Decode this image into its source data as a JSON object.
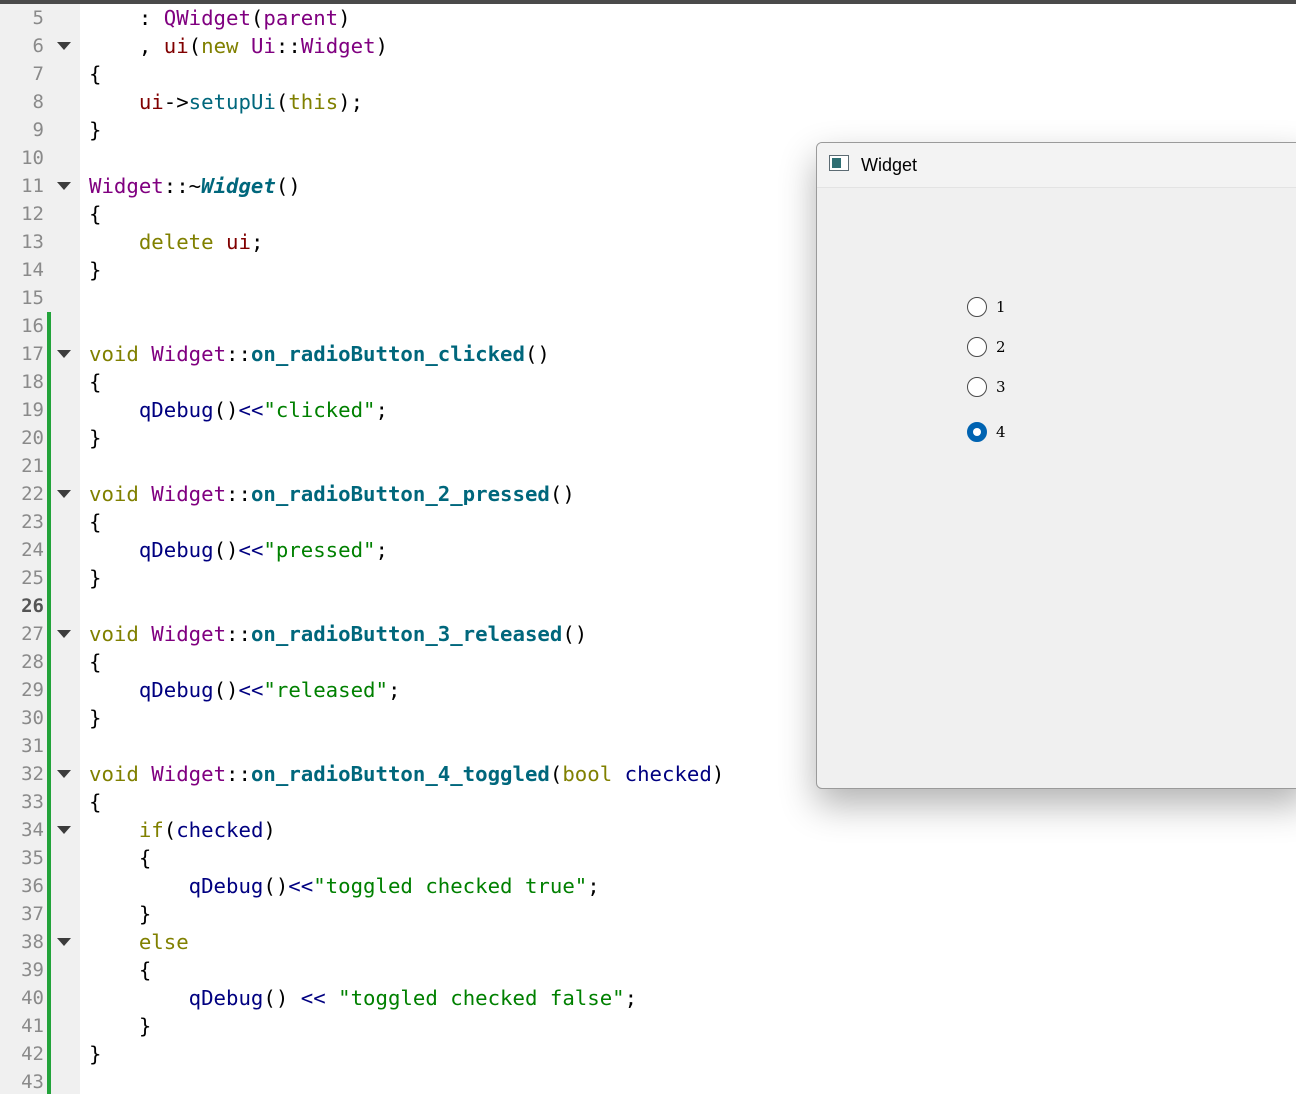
{
  "editor": {
    "current_line": "26",
    "lines": [
      {
        "n": "5",
        "fold": false,
        "tokens": [
          {
            "c": "op",
            "t": "    : "
          },
          {
            "c": "t",
            "t": "QWidget"
          },
          {
            "c": "op",
            "t": "("
          },
          {
            "c": "t",
            "t": "parent"
          },
          {
            "c": "op",
            "t": ")"
          }
        ]
      },
      {
        "n": "6",
        "fold": true,
        "tokens": [
          {
            "c": "op",
            "t": "    , "
          },
          {
            "c": "m",
            "t": "ui"
          },
          {
            "c": "op",
            "t": "("
          },
          {
            "c": "k",
            "t": "new"
          },
          {
            "c": "op",
            "t": " "
          },
          {
            "c": "t",
            "t": "Ui"
          },
          {
            "c": "op",
            "t": "::"
          },
          {
            "c": "t",
            "t": "Widget"
          },
          {
            "c": "op",
            "t": ")"
          }
        ]
      },
      {
        "n": "7",
        "fold": false,
        "tokens": [
          {
            "c": "op",
            "t": "{"
          }
        ]
      },
      {
        "n": "8",
        "fold": false,
        "tokens": [
          {
            "c": "op",
            "t": "    "
          },
          {
            "c": "m",
            "t": "ui"
          },
          {
            "c": "op",
            "t": "->"
          },
          {
            "c": "f",
            "t": "setupUi"
          },
          {
            "c": "op",
            "t": "("
          },
          {
            "c": "k",
            "t": "this"
          },
          {
            "c": "op",
            "t": ");"
          }
        ]
      },
      {
        "n": "9",
        "fold": false,
        "tokens": [
          {
            "c": "op",
            "t": "}"
          }
        ]
      },
      {
        "n": "10",
        "fold": false,
        "tokens": []
      },
      {
        "n": "11",
        "fold": true,
        "tokens": [
          {
            "c": "t",
            "t": "Widget"
          },
          {
            "c": "op",
            "t": "::~"
          },
          {
            "c": "fi",
            "t": "Widget"
          },
          {
            "c": "op",
            "t": "()"
          }
        ]
      },
      {
        "n": "12",
        "fold": false,
        "tokens": [
          {
            "c": "op",
            "t": "{"
          }
        ]
      },
      {
        "n": "13",
        "fold": false,
        "tokens": [
          {
            "c": "op",
            "t": "    "
          },
          {
            "c": "k",
            "t": "delete"
          },
          {
            "c": "op",
            "t": " "
          },
          {
            "c": "m",
            "t": "ui"
          },
          {
            "c": "op",
            "t": ";"
          }
        ]
      },
      {
        "n": "14",
        "fold": false,
        "tokens": [
          {
            "c": "op",
            "t": "}"
          }
        ]
      },
      {
        "n": "15",
        "fold": false,
        "tokens": []
      },
      {
        "n": "16",
        "fold": false,
        "tokens": []
      },
      {
        "n": "17",
        "fold": true,
        "tokens": [
          {
            "c": "k",
            "t": "void"
          },
          {
            "c": "op",
            "t": " "
          },
          {
            "c": "t",
            "t": "Widget"
          },
          {
            "c": "op",
            "t": "::"
          },
          {
            "c": "fb",
            "t": "on_radioButton_clicked"
          },
          {
            "c": "op",
            "t": "()"
          }
        ]
      },
      {
        "n": "18",
        "fold": false,
        "tokens": [
          {
            "c": "op",
            "t": "{"
          }
        ]
      },
      {
        "n": "19",
        "fold": false,
        "tokens": [
          {
            "c": "op",
            "t": "    "
          },
          {
            "c": "q",
            "t": "qDebug"
          },
          {
            "c": "op",
            "t": "()"
          },
          {
            "c": "q",
            "t": "<<"
          },
          {
            "c": "s",
            "t": "\"clicked\""
          },
          {
            "c": "op",
            "t": ";"
          }
        ]
      },
      {
        "n": "20",
        "fold": false,
        "tokens": [
          {
            "c": "op",
            "t": "}"
          }
        ]
      },
      {
        "n": "21",
        "fold": false,
        "tokens": []
      },
      {
        "n": "22",
        "fold": true,
        "tokens": [
          {
            "c": "k",
            "t": "void"
          },
          {
            "c": "op",
            "t": " "
          },
          {
            "c": "t",
            "t": "Widget"
          },
          {
            "c": "op",
            "t": "::"
          },
          {
            "c": "fb",
            "t": "on_radioButton_2_pressed"
          },
          {
            "c": "op",
            "t": "()"
          }
        ]
      },
      {
        "n": "23",
        "fold": false,
        "tokens": [
          {
            "c": "op",
            "t": "{"
          }
        ]
      },
      {
        "n": "24",
        "fold": false,
        "tokens": [
          {
            "c": "op",
            "t": "    "
          },
          {
            "c": "q",
            "t": "qDebug"
          },
          {
            "c": "op",
            "t": "()"
          },
          {
            "c": "q",
            "t": "<<"
          },
          {
            "c": "s",
            "t": "\"pressed\""
          },
          {
            "c": "op",
            "t": ";"
          }
        ]
      },
      {
        "n": "25",
        "fold": false,
        "tokens": [
          {
            "c": "op",
            "t": "}"
          }
        ]
      },
      {
        "n": "26",
        "fold": false,
        "tokens": []
      },
      {
        "n": "27",
        "fold": true,
        "tokens": [
          {
            "c": "k",
            "t": "void"
          },
          {
            "c": "op",
            "t": " "
          },
          {
            "c": "t",
            "t": "Widget"
          },
          {
            "c": "op",
            "t": "::"
          },
          {
            "c": "fb",
            "t": "on_radioButton_3_released"
          },
          {
            "c": "op",
            "t": "()"
          }
        ]
      },
      {
        "n": "28",
        "fold": false,
        "tokens": [
          {
            "c": "op",
            "t": "{"
          }
        ]
      },
      {
        "n": "29",
        "fold": false,
        "tokens": [
          {
            "c": "op",
            "t": "    "
          },
          {
            "c": "q",
            "t": "qDebug"
          },
          {
            "c": "op",
            "t": "()"
          },
          {
            "c": "q",
            "t": "<<"
          },
          {
            "c": "s",
            "t": "\"released\""
          },
          {
            "c": "op",
            "t": ";"
          }
        ]
      },
      {
        "n": "30",
        "fold": false,
        "tokens": [
          {
            "c": "op",
            "t": "}"
          }
        ]
      },
      {
        "n": "31",
        "fold": false,
        "tokens": []
      },
      {
        "n": "32",
        "fold": true,
        "tokens": [
          {
            "c": "k",
            "t": "void"
          },
          {
            "c": "op",
            "t": " "
          },
          {
            "c": "t",
            "t": "Widget"
          },
          {
            "c": "op",
            "t": "::"
          },
          {
            "c": "fb",
            "t": "on_radioButton_4_toggled"
          },
          {
            "c": "op",
            "t": "("
          },
          {
            "c": "k",
            "t": "bool"
          },
          {
            "c": "op",
            "t": " "
          },
          {
            "c": "q",
            "t": "checked"
          },
          {
            "c": "op",
            "t": ")"
          }
        ]
      },
      {
        "n": "33",
        "fold": false,
        "tokens": [
          {
            "c": "op",
            "t": "{"
          }
        ]
      },
      {
        "n": "34",
        "fold": true,
        "tokens": [
          {
            "c": "op",
            "t": "    "
          },
          {
            "c": "k",
            "t": "if"
          },
          {
            "c": "op",
            "t": "("
          },
          {
            "c": "q",
            "t": "checked"
          },
          {
            "c": "op",
            "t": ")"
          }
        ]
      },
      {
        "n": "35",
        "fold": false,
        "tokens": [
          {
            "c": "op",
            "t": "    {"
          }
        ]
      },
      {
        "n": "36",
        "fold": false,
        "tokens": [
          {
            "c": "op",
            "t": "        "
          },
          {
            "c": "q",
            "t": "qDebug"
          },
          {
            "c": "op",
            "t": "()"
          },
          {
            "c": "q",
            "t": "<<"
          },
          {
            "c": "s",
            "t": "\"toggled checked true\""
          },
          {
            "c": "op",
            "t": ";"
          }
        ]
      },
      {
        "n": "37",
        "fold": false,
        "tokens": [
          {
            "c": "op",
            "t": "    }"
          }
        ]
      },
      {
        "n": "38",
        "fold": true,
        "tokens": [
          {
            "c": "op",
            "t": "    "
          },
          {
            "c": "k",
            "t": "else"
          }
        ]
      },
      {
        "n": "39",
        "fold": false,
        "tokens": [
          {
            "c": "op",
            "t": "    {"
          }
        ]
      },
      {
        "n": "40",
        "fold": false,
        "tokens": [
          {
            "c": "op",
            "t": "        "
          },
          {
            "c": "q",
            "t": "qDebug"
          },
          {
            "c": "op",
            "t": "() "
          },
          {
            "c": "q",
            "t": "<<"
          },
          {
            "c": "op",
            "t": " "
          },
          {
            "c": "s",
            "t": "\"toggled checked false\""
          },
          {
            "c": "op",
            "t": ";"
          }
        ]
      },
      {
        "n": "41",
        "fold": false,
        "tokens": [
          {
            "c": "op",
            "t": "    }"
          }
        ]
      },
      {
        "n": "42",
        "fold": false,
        "tokens": [
          {
            "c": "op",
            "t": "}"
          }
        ]
      },
      {
        "n": "43",
        "fold": false,
        "tokens": []
      }
    ]
  },
  "widget_window": {
    "title": "Widget",
    "radio_buttons": [
      {
        "label": "1",
        "checked": false
      },
      {
        "label": "2",
        "checked": false
      },
      {
        "label": "3",
        "checked": false
      },
      {
        "label": "4",
        "checked": true
      }
    ]
  },
  "colors": {
    "keyword": "#808000",
    "type": "#800080",
    "function": "#00677c",
    "member": "#800000",
    "string": "#008000",
    "debug": "#000080",
    "change_bar": "#22a33a",
    "radio_checked": "#0063b1"
  }
}
